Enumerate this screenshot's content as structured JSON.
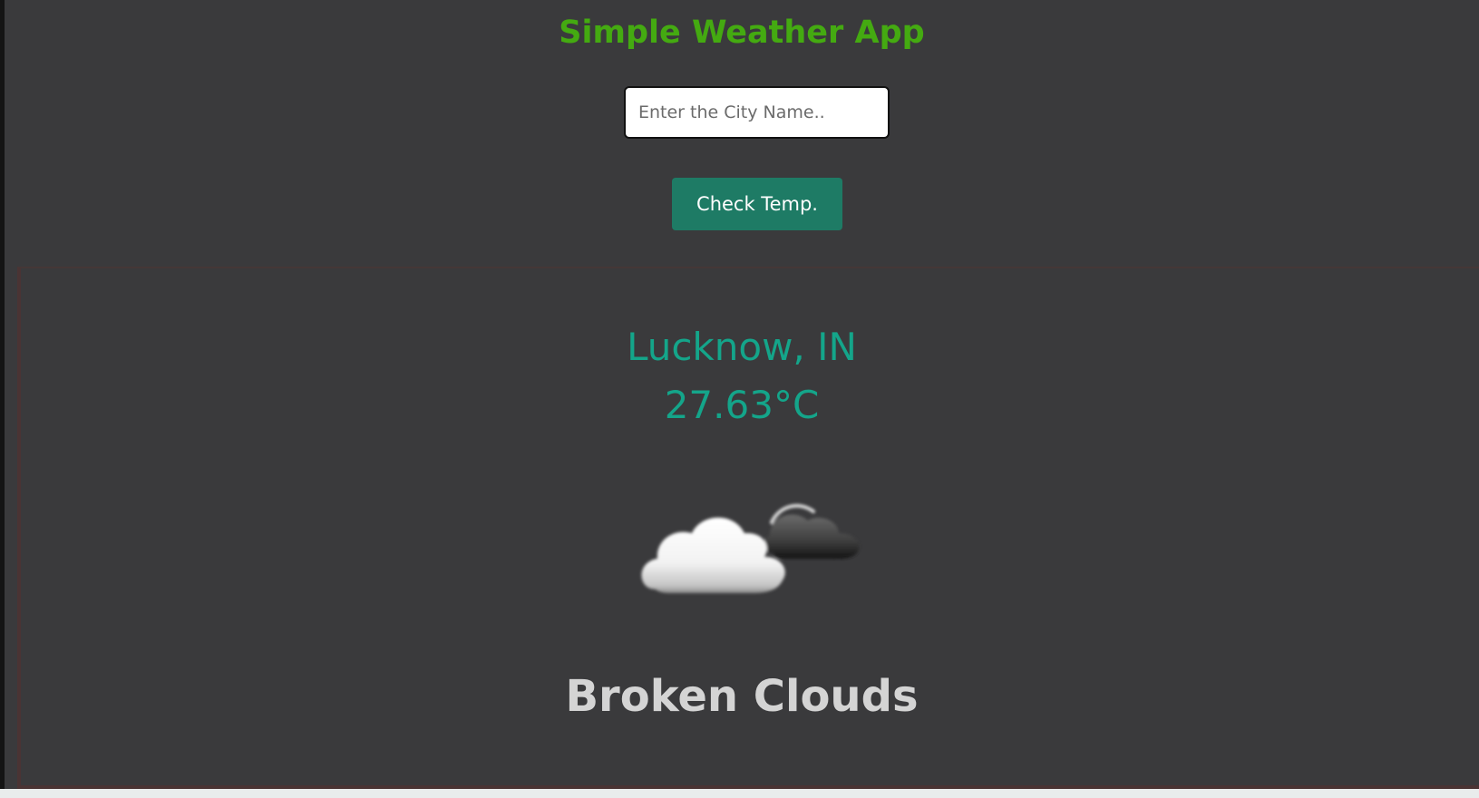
{
  "header": {
    "title": "Simple Weather App",
    "title_color": "#44aa11"
  },
  "search": {
    "placeholder": "Enter the City Name..",
    "value": ""
  },
  "actions": {
    "check_label": "Check Temp.",
    "button_color": "#1e7b65"
  },
  "result": {
    "location": "Lucknow, IN",
    "temperature": "27.63°C",
    "icon": "broken-clouds-icon",
    "description": "Broken Clouds",
    "accent_color": "#14a58a"
  },
  "theme": {
    "background": "#3a3a3c"
  }
}
